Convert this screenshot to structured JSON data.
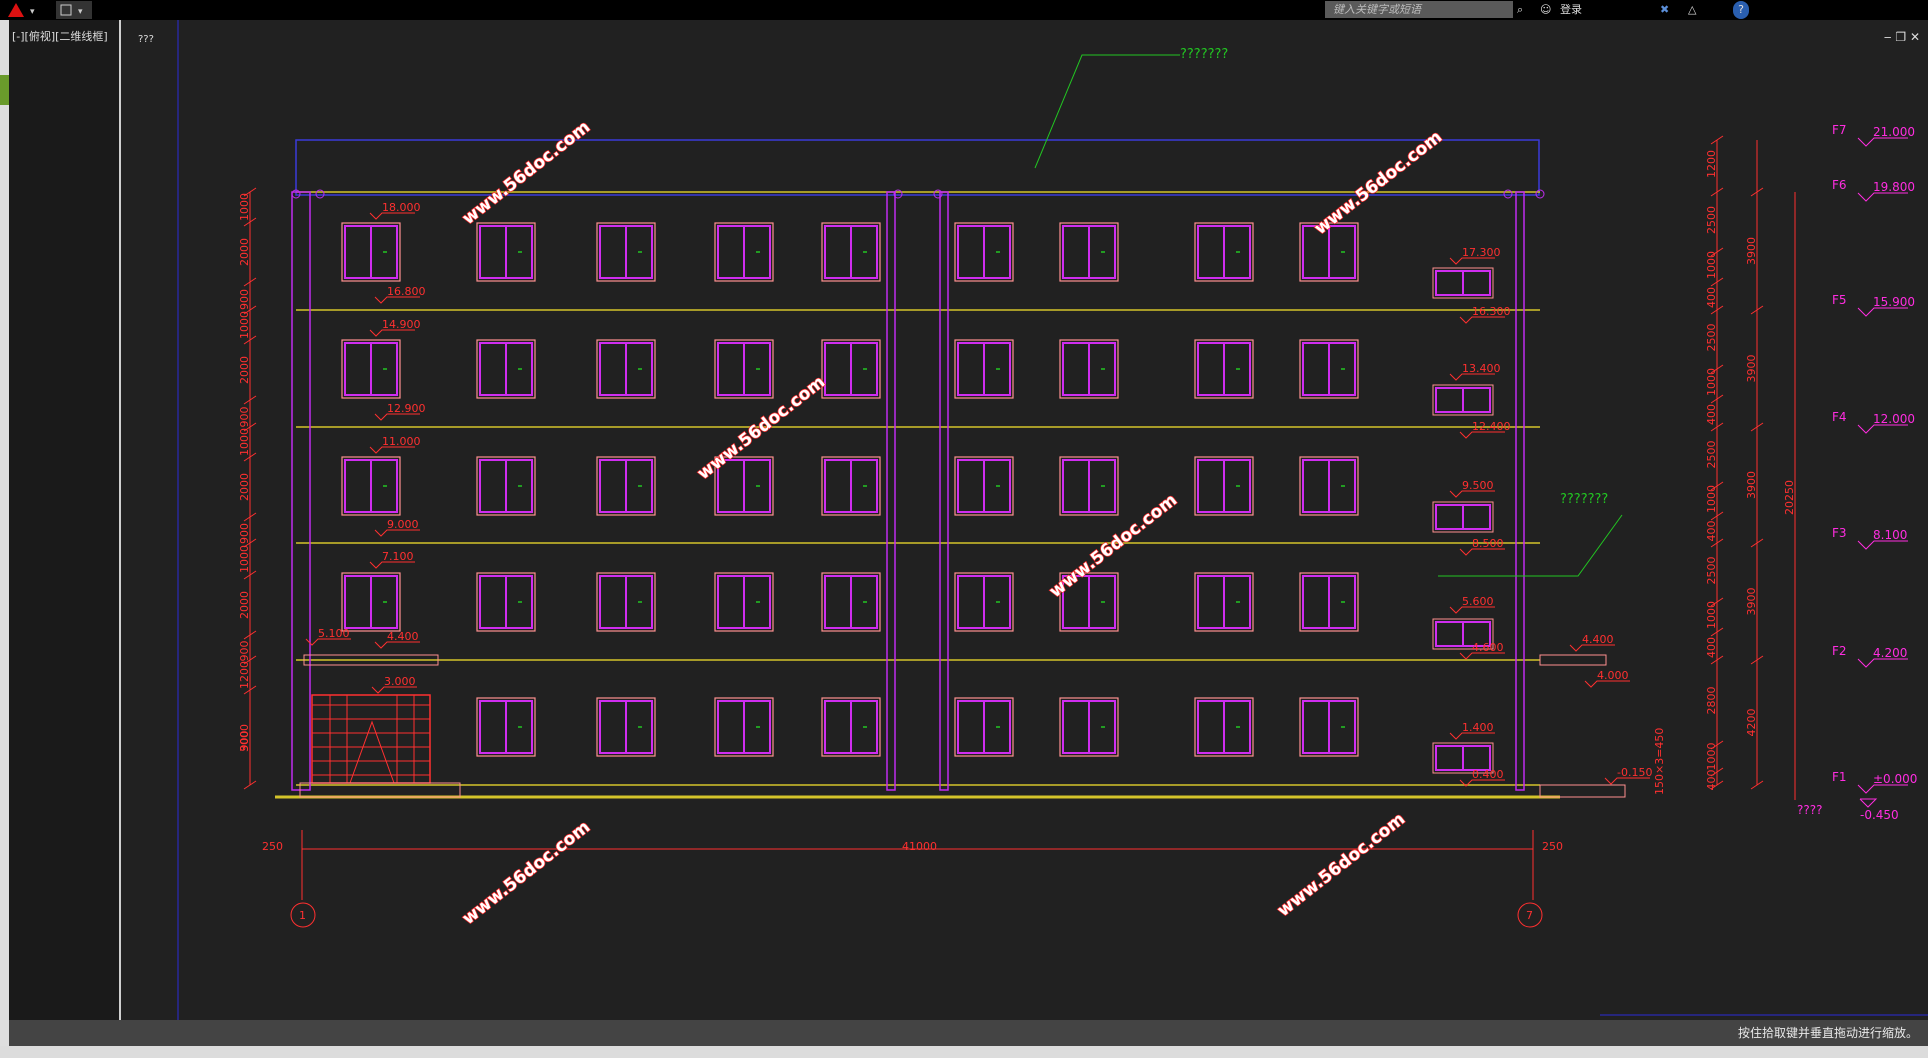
{
  "window": {
    "search_placeholder": "键入关键字或短语",
    "login_label": "登录",
    "help_label": "?",
    "minimize": "‒",
    "restore": "❐",
    "close": "✕"
  },
  "viewport_label": "[-][俯视][二维线框]",
  "viewcube_label": "???",
  "status_text": "按住拾取键并垂直拖动进行缩放。",
  "drawing": {
    "notes": [
      "???????",
      "???????"
    ],
    "total_dimension": "41000",
    "end_dimensions": [
      "250",
      "250"
    ],
    "axis_labels": [
      "1",
      "7"
    ],
    "floor_labels": [
      {
        "name": "F7",
        "elev": "21.000"
      },
      {
        "name": "F6",
        "elev": "19.800"
      },
      {
        "name": "F5",
        "elev": "15.900"
      },
      {
        "name": "F4",
        "elev": "12.000"
      },
      {
        "name": "F3",
        "elev": "8.100"
      },
      {
        "name": "F2",
        "elev": "4.200"
      },
      {
        "name": "F1",
        "elev": "±0.000"
      }
    ],
    "ground_level": "-0.450",
    "ground_tag": "????",
    "left_dims": [
      "1000",
      "2000",
      "900",
      "1000",
      "2000",
      "900",
      "1000",
      "2000",
      "900",
      "1000",
      "2000",
      "900",
      "1200",
      "900",
      "3000"
    ],
    "right_dims_1": [
      "1200",
      "2500",
      "1000",
      "400",
      "2500",
      "1000",
      "400",
      "2500",
      "1000",
      "400",
      "2500",
      "1000",
      "400",
      "2800",
      "1000",
      "400"
    ],
    "right_dims_2": [
      "3900",
      "3900",
      "3900",
      "3900",
      "4200"
    ],
    "right_total": "20250",
    "step_dim": "150×3=450",
    "left_elevs": [
      {
        "top": "18.000",
        "bottom": "16.800"
      },
      {
        "top": "14.900",
        "bottom": "12.900"
      },
      {
        "top": "11.000",
        "bottom": "9.000"
      },
      {
        "top": "7.100",
        "bottom": "4.400"
      }
    ],
    "canopy_elev": "5.100",
    "door_elev": "3.000",
    "right_win_elevs": [
      {
        "top": "17.300",
        "bottom": "16.300"
      },
      {
        "top": "13.400",
        "bottom": "12.400"
      },
      {
        "top": "9.500",
        "bottom": "8.500"
      },
      {
        "top": "5.600",
        "bottom": "4.600"
      },
      {
        "top": "1.400",
        "bottom": "0.400"
      }
    ],
    "right_canopy": {
      "top": "4.400",
      "bottom": "4.000"
    },
    "base_elev": "-0.150",
    "watermark": "www.56doc.com"
  }
}
